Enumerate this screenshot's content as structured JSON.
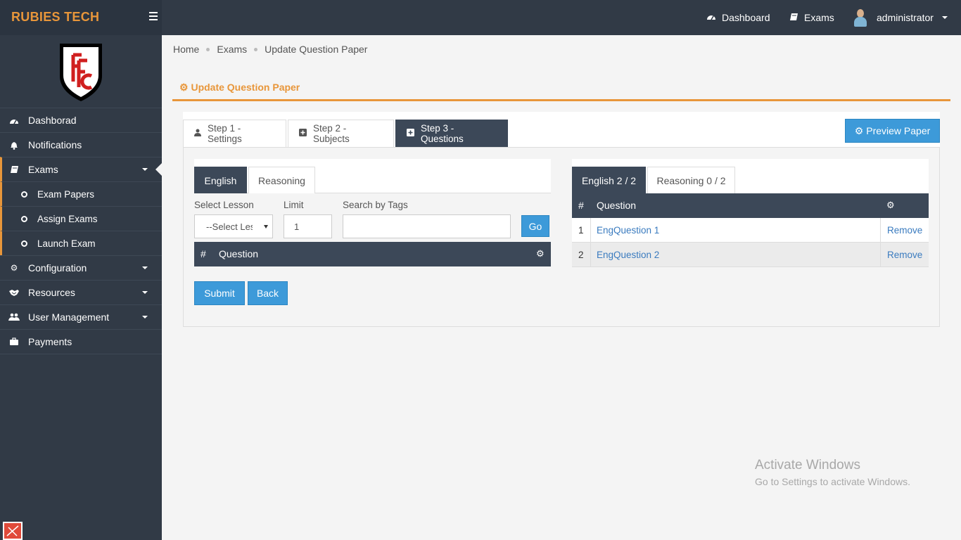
{
  "brand": "RUBIES TECH",
  "topnav": {
    "dashboard": "Dashboard",
    "exams": "Exams",
    "user": "administrator"
  },
  "sidebar": {
    "items": [
      {
        "label": "Dashborad",
        "icon": "dashboard-icon"
      },
      {
        "label": "Notifications",
        "icon": "bell-icon"
      },
      {
        "label": "Exams",
        "icon": "book-icon"
      },
      {
        "label": "Configuration",
        "icon": "gear-icon"
      },
      {
        "label": "Resources",
        "icon": "handshake-icon"
      },
      {
        "label": "User Management",
        "icon": "users-icon"
      },
      {
        "label": "Payments",
        "icon": "briefcase-icon"
      }
    ],
    "exam_sub": [
      "Exam Papers",
      "Assign Exams",
      "Launch Exam"
    ]
  },
  "breadcrumb": [
    "Home",
    "Exams",
    "Update Question Paper"
  ],
  "page_title": "Update Question Paper",
  "steps": [
    {
      "label": "Step 1 - Settings"
    },
    {
      "label": "Step 2 - Subjects"
    },
    {
      "label": "Step 3 - Questions"
    }
  ],
  "preview_button": "Preview Paper",
  "left_panel": {
    "tabs": [
      "English",
      "Reasoning"
    ],
    "select_lesson_label": "Select Lesson",
    "select_lesson_value": "--Select Lesson--",
    "limit_label": "Limit",
    "limit_value": "1",
    "search_label": "Search by Tags",
    "search_value": "",
    "go_button": "Go",
    "table_headers": [
      "#",
      "Question"
    ]
  },
  "buttons": {
    "submit": "Submit",
    "back": "Back"
  },
  "right_panel": {
    "tabs": [
      "English 2 / 2",
      "Reasoning 0 / 2"
    ],
    "table_headers": [
      "#",
      "Question"
    ],
    "rows": [
      {
        "num": "1",
        "question": "EngQuestion 1",
        "action": "Remove"
      },
      {
        "num": "2",
        "question": "EngQuestion 2",
        "action": "Remove"
      }
    ]
  },
  "watermark": {
    "title": "Activate Windows",
    "subtitle": "Go to Settings to activate Windows."
  },
  "colors": {
    "accent": "#e8963a",
    "nav_bg": "#313a46",
    "primary": "#3d9ad9",
    "link": "#3a7bbf"
  }
}
